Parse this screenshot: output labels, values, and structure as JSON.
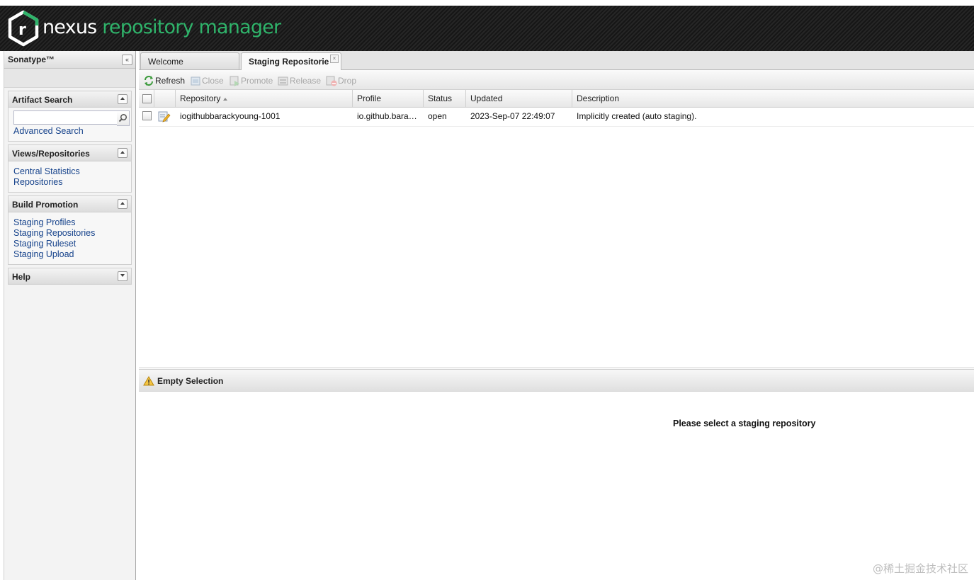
{
  "header": {
    "brand_word1": "nexus",
    "brand_word2": "repository manager",
    "logo_letter": "r",
    "accent_color": "#2fb36a"
  },
  "sidebar": {
    "title": "Sonatype™",
    "collapse_icon": "double-chevron-left-icon",
    "panels": [
      {
        "title": "Artifact Search",
        "search_value": "",
        "search_icon": "search-icon",
        "links": [
          "Advanced Search"
        ]
      },
      {
        "title": "Views/Repositories",
        "links": [
          "Central Statistics",
          "Repositories"
        ]
      },
      {
        "title": "Build Promotion",
        "links": [
          "Staging Profiles",
          "Staging Repositories",
          "Staging Ruleset",
          "Staging Upload"
        ]
      },
      {
        "title": "Help",
        "links": []
      }
    ]
  },
  "tabs": [
    {
      "label": "Welcome",
      "active": false
    },
    {
      "label": "Staging Repositorie",
      "active": true,
      "closable": true
    }
  ],
  "toolbar": {
    "buttons": [
      {
        "label": "Refresh",
        "icon": "refresh-icon",
        "enabled": true
      },
      {
        "label": "Close",
        "icon": "close-repo-icon",
        "enabled": false
      },
      {
        "label": "Promote",
        "icon": "promote-icon",
        "enabled": false
      },
      {
        "label": "Release",
        "icon": "release-icon",
        "enabled": false
      },
      {
        "label": "Drop",
        "icon": "drop-icon",
        "enabled": false
      }
    ]
  },
  "grid": {
    "columns": [
      "Repository",
      "Profile",
      "Status",
      "Updated",
      "Description"
    ],
    "sorted_column": "Repository",
    "rows": [
      {
        "repository": "iogithubbarackyoung-1001",
        "profile": "io.github.bara…",
        "status": "open",
        "updated": "2023-Sep-07 22:49:07",
        "description": "Implicitly created (auto staging).",
        "icon": "edit-repository-icon"
      }
    ]
  },
  "detail": {
    "title": "Empty Selection",
    "icon": "warning-icon",
    "message": "Please select a staging repository"
  },
  "watermark": "@稀土掘金技术社区"
}
